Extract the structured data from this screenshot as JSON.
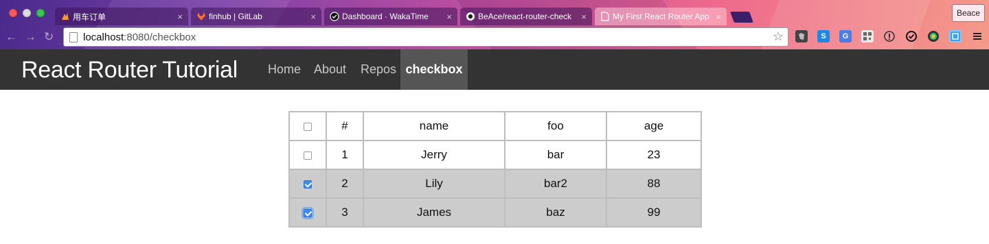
{
  "browser": {
    "tabs": [
      {
        "title": "用车订单",
        "favicon": "flame-icon",
        "active": false
      },
      {
        "title": "finhub | GitLab",
        "favicon": "gitlab-icon",
        "active": false
      },
      {
        "title": "Dashboard · WakaTime",
        "favicon": "wakatime-icon",
        "active": false
      },
      {
        "title": "BeAce/react-router-check",
        "favicon": "github-icon",
        "active": false
      },
      {
        "title": "My First React Router App",
        "favicon": "page-icon",
        "active": true
      }
    ],
    "close_glyph": "×",
    "profile_name": "Beace",
    "url_host": "localhost",
    "url_rest": ":8080/checkbox",
    "nav": {
      "back": "←",
      "forward": "→",
      "reload": "↻"
    },
    "bookmark_glyph": "☆",
    "extensions": [
      "evernote-icon",
      "s-icon",
      "translate-icon",
      "qr-icon",
      "info-icon",
      "check-icon",
      "color-icon",
      "screenshot-icon",
      "menu-icon"
    ]
  },
  "app": {
    "brand": "React Router Tutorial",
    "nav": [
      {
        "label": "Home",
        "active": false
      },
      {
        "label": "About",
        "active": false
      },
      {
        "label": "Repos",
        "active": false
      },
      {
        "label": "checkbox",
        "active": true
      }
    ]
  },
  "table": {
    "headers": [
      "#",
      "name",
      "foo",
      "age"
    ],
    "select_all_checked": false,
    "rows": [
      {
        "id": "1",
        "name": "Jerry",
        "foo": "bar",
        "age": "23",
        "checked": false
      },
      {
        "id": "2",
        "name": "Lily",
        "foo": "bar2",
        "age": "88",
        "checked": true
      },
      {
        "id": "3",
        "name": "James",
        "foo": "baz",
        "age": "99",
        "checked": true
      }
    ]
  },
  "colors": {
    "navbar_bg": "#333333",
    "nav_active_bg": "#555555",
    "selected_row_bg": "#cccccc",
    "checkbox_checked": "#3a8df5"
  }
}
